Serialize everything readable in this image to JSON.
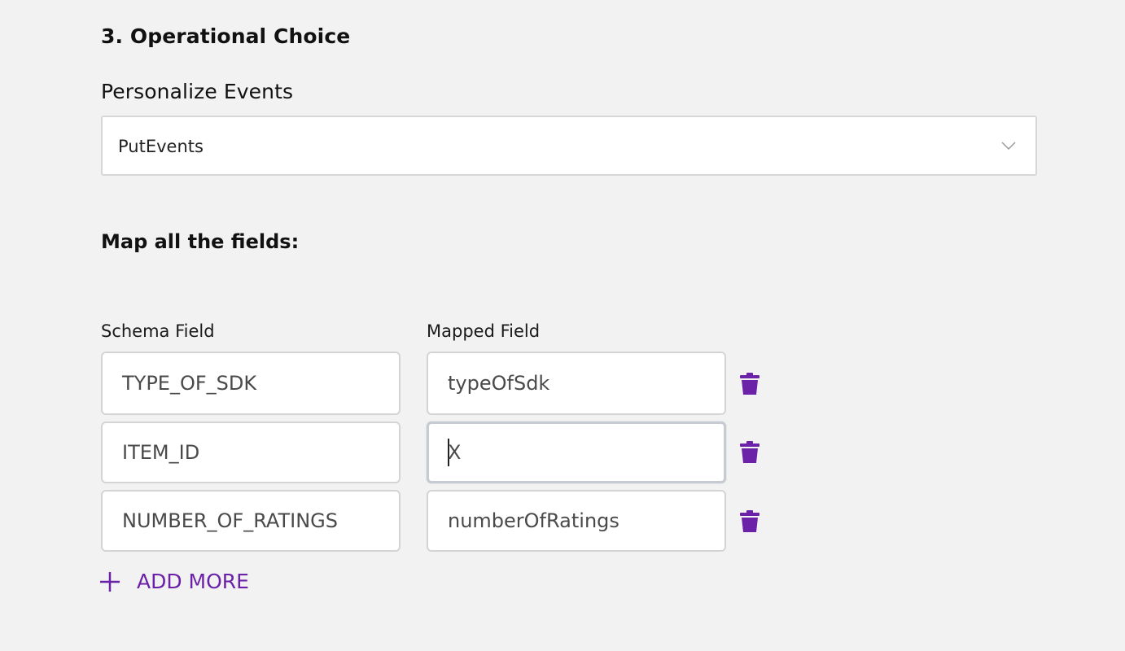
{
  "section": {
    "title": "3. Operational Choice"
  },
  "personalize_events": {
    "label": "Personalize Events",
    "selected": "PutEvents"
  },
  "mapping": {
    "title": "Map all the fields:",
    "schema_header": "Schema Field",
    "mapped_header": "Mapped Field",
    "rows": [
      {
        "schema": "TYPE_OF_SDK",
        "mapped": "typeOfSdk"
      },
      {
        "schema": "ITEM_ID",
        "mapped": "X"
      },
      {
        "schema": "NUMBER_OF_RATINGS",
        "mapped": "numberOfRatings"
      }
    ],
    "add_more_label": "ADD MORE"
  },
  "icons": {
    "dropdown": "chevron-down-icon",
    "delete": "trash-icon",
    "add": "plus-icon"
  },
  "colors": {
    "accent": "#6b21a8",
    "background": "#f2f2f2"
  }
}
